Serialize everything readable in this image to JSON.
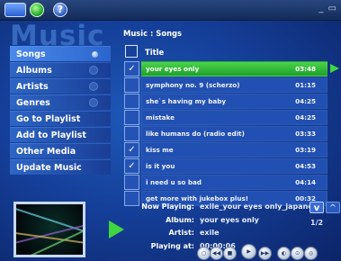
{
  "window": {
    "min_max": "_ ▭"
  },
  "toolbar": {
    "help_label": "?"
  },
  "logo": "Music",
  "breadcrumb": "Music : Songs",
  "list_header": {
    "title": "Title"
  },
  "menu": [
    {
      "label": "Songs",
      "selected": true
    },
    {
      "label": "Albums"
    },
    {
      "label": "Artists"
    },
    {
      "label": "Genres"
    },
    {
      "label": "Go to Playlist"
    },
    {
      "label": "Add to Playlist"
    },
    {
      "label": "Other Media"
    },
    {
      "label": "Update Music"
    }
  ],
  "songs": [
    {
      "title": "your eyes only",
      "duration": "03:48",
      "checked": "✓",
      "playing": true
    },
    {
      "title": "symphony no. 9 (scherzo)",
      "duration": "01:15",
      "checked": ""
    },
    {
      "title": "she`s having my baby",
      "duration": "04:25",
      "checked": ""
    },
    {
      "title": "mistake",
      "duration": "04:25",
      "checked": ""
    },
    {
      "title": "like humans do (radio edit)",
      "duration": "03:33",
      "checked": ""
    },
    {
      "title": "kiss me",
      "duration": "03:19",
      "checked": "✓"
    },
    {
      "title": "is it you",
      "duration": "04:53",
      "checked": "✓"
    },
    {
      "title": "i need u so bad",
      "duration": "04:14",
      "checked": ""
    },
    {
      "title": "get more with jukebox plus!",
      "duration": "00:32",
      "checked": ""
    }
  ],
  "now_playing": {
    "labels": {
      "now_playing": "Now Playing:",
      "album": "Album:",
      "artist": "Artist:",
      "playing_at": "Playing at:"
    },
    "file": "exile_your eyes only_japanese.",
    "album": "your eyes only",
    "artist": "exile",
    "playing_at": "00:00:06"
  },
  "pager": {
    "indicator": "1/2",
    "down_icon": "v",
    "up_icon": "^"
  },
  "transport": [
    "○",
    "◀◀",
    "■",
    "▶",
    "▶▶",
    "◐",
    "⊙",
    "◎"
  ],
  "colors": {
    "selected_song": "#2fbf37",
    "accent": "#2b65cc",
    "play_arrow": "#40d640"
  }
}
